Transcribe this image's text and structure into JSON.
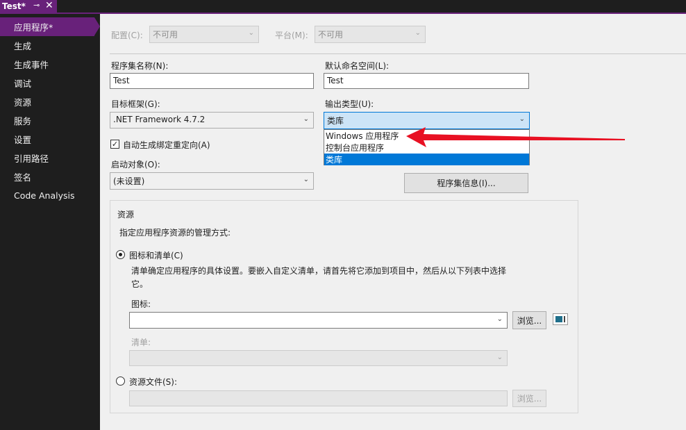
{
  "tab": {
    "title": "Test*",
    "pin_icon": "⊸",
    "close_icon": "✕"
  },
  "sidebar": {
    "items": [
      {
        "label": "应用程序*",
        "active": true
      },
      {
        "label": "生成"
      },
      {
        "label": "生成事件"
      },
      {
        "label": "调试"
      },
      {
        "label": "资源"
      },
      {
        "label": "服务"
      },
      {
        "label": "设置"
      },
      {
        "label": "引用路径"
      },
      {
        "label": "签名"
      },
      {
        "label": "Code Analysis"
      }
    ]
  },
  "toprow": {
    "config_label": "配置(C):",
    "config_value": "不可用",
    "platform_label": "平台(M):",
    "platform_value": "不可用"
  },
  "assembly": {
    "label": "程序集名称(N):",
    "value": "Test"
  },
  "namespace": {
    "label": "默认命名空间(L):",
    "value": "Test"
  },
  "framework": {
    "label": "目标框架(G):",
    "value": ".NET Framework 4.7.2"
  },
  "output": {
    "label": "输出类型(U):",
    "value": "类库",
    "options": [
      "Windows 应用程序",
      "控制台应用程序",
      "类库"
    ],
    "selected_index": 2
  },
  "autobind": {
    "label": "自动生成绑定重定向(A)",
    "checked": true
  },
  "startup": {
    "label": "启动对象(O):",
    "value": "(未设置)"
  },
  "assembly_info_button": "程序集信息(I)...",
  "resources": {
    "title": "资源",
    "subtitle": "指定应用程序资源的管理方式:",
    "icon_manifest_label": "图标和清单(C)",
    "description": "清单确定应用程序的具体设置。要嵌入自定义清单，请首先将它添加到项目中，然后从以下列表中选择它。",
    "icon_label": "图标:",
    "icon_value": "",
    "browse_label": "浏览...",
    "manifest_label": "清单:",
    "manifest_value": "",
    "resource_file_label": "资源文件(S):",
    "resource_file_value": "",
    "browse2_label": "浏览..."
  },
  "colors": {
    "accent": "#68217a",
    "selection": "#0078d7",
    "arrow": "#e81123"
  }
}
